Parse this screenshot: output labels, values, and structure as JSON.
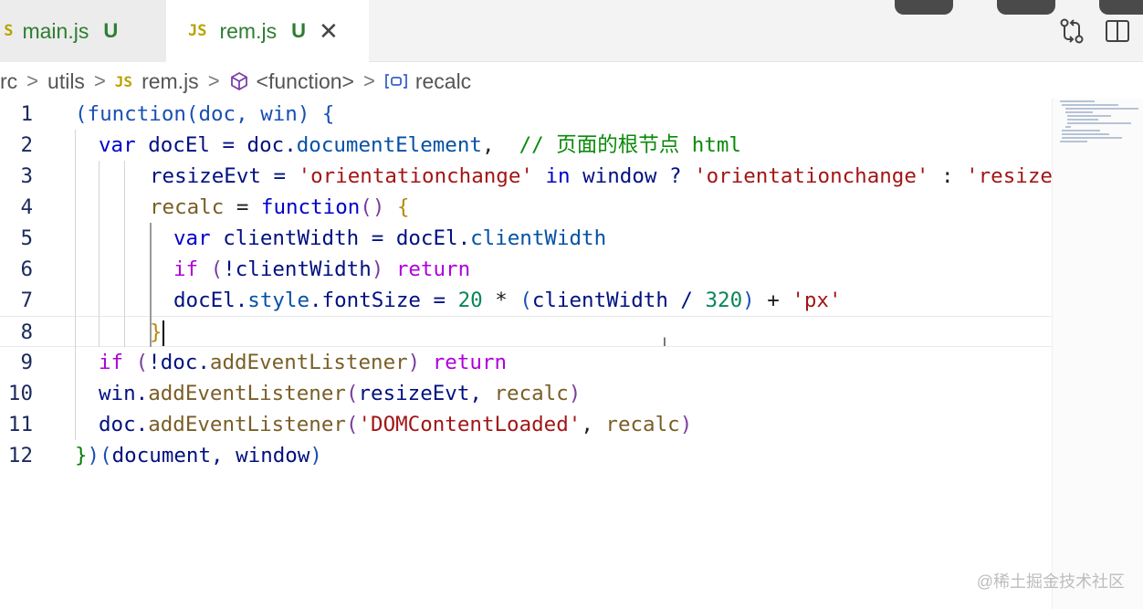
{
  "tabs": [
    {
      "icon": "JS",
      "name": "main.js",
      "status": "U"
    },
    {
      "icon": "JS",
      "name": "rem.js",
      "status": "U",
      "close": "✕"
    }
  ],
  "breadcrumb": {
    "items": [
      "rc",
      "utils",
      "rem.js",
      "<function>",
      "recalc"
    ],
    "js_icon": "JS",
    "separator": ">"
  },
  "icons": {
    "source_control": "compare-icon",
    "split_editor": "split-editor-icon",
    "cube": "cube-icon",
    "variable": "variable-icon"
  },
  "editor": {
    "lines": [
      {
        "n": "1",
        "tokens": [
          [
            "#1a4fb3",
            "(function(doc, win) {"
          ]
        ]
      },
      {
        "n": "2",
        "tokens": [
          [
            "#0000cc",
            "var "
          ],
          [
            "#001080",
            "docEl = doc."
          ],
          [
            "#0451a5",
            "documentElement"
          ],
          [
            "#1f1f1f",
            ",  "
          ],
          [
            "#0a8a0a",
            "// 页面的根节点 html"
          ]
        ]
      },
      {
        "n": "3",
        "tokens": [
          [
            "#001080",
            "resizeEvt = "
          ],
          [
            "#a31515",
            "'orientationchange'"
          ],
          [
            "#0000cc",
            " in "
          ],
          [
            "#001080",
            "window ? "
          ],
          [
            "#a31515",
            "'orientationchange'"
          ],
          [
            "#1f1f1f",
            " : "
          ],
          [
            "#a31515",
            "'resize"
          ]
        ]
      },
      {
        "n": "4",
        "tokens": [
          [
            "#795e26",
            "recalc"
          ],
          [
            "#1f1f1f",
            " = "
          ],
          [
            "#0000cc",
            "function"
          ],
          [
            "#7a3e9d",
            "() "
          ],
          [
            "#b8860b",
            "{"
          ]
        ]
      },
      {
        "n": "5",
        "tokens": [
          [
            "#0000cc",
            "var "
          ],
          [
            "#001080",
            "clientWidth = docEl."
          ],
          [
            "#0451a5",
            "clientWidth"
          ]
        ]
      },
      {
        "n": "6",
        "tokens": [
          [
            "#af00db",
            "if "
          ],
          [
            "#7a3e9d",
            "("
          ],
          [
            "#001080",
            "!clientWidth"
          ],
          [
            "#7a3e9d",
            ") "
          ],
          [
            "#af00db",
            "return"
          ]
        ]
      },
      {
        "n": "7",
        "tokens": [
          [
            "#001080",
            "docEl."
          ],
          [
            "#0451a5",
            "style"
          ],
          [
            "#001080",
            ".fontSize = "
          ],
          [
            "#098658",
            "20"
          ],
          [
            "#1f1f1f",
            " * "
          ],
          [
            "#1a4fb3",
            "("
          ],
          [
            "#001080",
            "clientWidth / "
          ],
          [
            "#098658",
            "320"
          ],
          [
            "#1a4fb3",
            ")"
          ],
          [
            "#1f1f1f",
            " + "
          ],
          [
            "#a31515",
            "'px'"
          ]
        ]
      },
      {
        "n": "8",
        "tokens": [
          [
            "#b8860b",
            "}"
          ]
        ]
      },
      {
        "n": "9",
        "tokens": [
          [
            "#af00db",
            "if "
          ],
          [
            "#7a3e9d",
            "("
          ],
          [
            "#001080",
            "!doc."
          ],
          [
            "#795e26",
            "addEventListener"
          ],
          [
            "#7a3e9d",
            ") "
          ],
          [
            "#af00db",
            "return"
          ]
        ]
      },
      {
        "n": "10",
        "tokens": [
          [
            "#001080",
            "win."
          ],
          [
            "#795e26",
            "addEventListener"
          ],
          [
            "#7a3e9d",
            "("
          ],
          [
            "#001080",
            "resizeEvt, "
          ],
          [
            "#795e26",
            "recalc"
          ],
          [
            "#7a3e9d",
            ")"
          ]
        ]
      },
      {
        "n": "11",
        "tokens": [
          [
            "#001080",
            "doc."
          ],
          [
            "#795e26",
            "addEventListener"
          ],
          [
            "#7a3e9d",
            "("
          ],
          [
            "#a31515",
            "'DOMContentLoaded'"
          ],
          [
            "#1f1f1f",
            ", "
          ],
          [
            "#795e26",
            "recalc"
          ],
          [
            "#7a3e9d",
            ")"
          ]
        ]
      },
      {
        "n": "12",
        "tokens": [
          [
            "#0a7a0a",
            "}"
          ],
          [
            "#1a4fb3",
            ")("
          ],
          [
            "#001080",
            "document, window"
          ],
          [
            "#1a4fb3",
            ")"
          ]
        ]
      }
    ]
  },
  "watermark": "@稀土掘金技术社区"
}
